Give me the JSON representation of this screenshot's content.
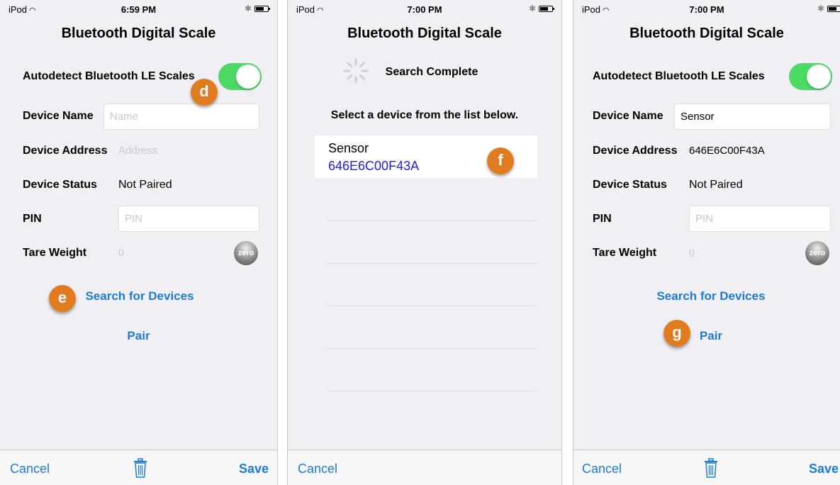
{
  "screens": [
    {
      "status": {
        "carrier": "iPod",
        "time": "6:59 PM"
      },
      "title": "Bluetooth Digital Scale",
      "autodetect_label": "Autodetect Bluetooth LE Scales",
      "device_name_label": "Device Name",
      "device_name_value": "",
      "device_name_placeholder": "Name",
      "device_address_label": "Device Address",
      "device_address_value": "Address",
      "device_status_label": "Device Status",
      "device_status_value": "Not Paired",
      "pin_label": "PIN",
      "pin_value": "",
      "pin_placeholder": "PIN",
      "tare_label": "Tare Weight",
      "tare_value": "0",
      "zero_label": "zero",
      "search_link": "Search for Devices",
      "pair_link": "Pair",
      "cancel_label": "Cancel",
      "save_label": "Save"
    },
    {
      "status": {
        "carrier": "iPod",
        "time": "7:00 PM"
      },
      "title": "Bluetooth Digital Scale",
      "search_status": "Search Complete",
      "instruction": "Select a device from the list below.",
      "devices": [
        {
          "name": "Sensor",
          "address": "646E6C00F43A"
        }
      ],
      "cancel_label": "Cancel"
    },
    {
      "status": {
        "carrier": "iPod",
        "time": "7:00 PM"
      },
      "title": "Bluetooth Digital Scale",
      "autodetect_label": "Autodetect Bluetooth LE Scales",
      "device_name_label": "Device Name",
      "device_name_value": "Sensor",
      "device_address_label": "Device Address",
      "device_address_value": "646E6C00F43A",
      "device_status_label": "Device Status",
      "device_status_value": "Not Paired",
      "pin_label": "PIN",
      "pin_value": "",
      "pin_placeholder": "PIN",
      "tare_label": "Tare Weight",
      "tare_value": "0",
      "zero_label": "zero",
      "search_link": "Search for Devices",
      "pair_link": "Pair",
      "cancel_label": "Cancel",
      "save_label": "Save"
    }
  ],
  "callouts": {
    "d": "d",
    "e": "e",
    "f": "f",
    "g": "g"
  },
  "colors": {
    "accent": "#1e7cd8",
    "toggle_on": "#4cd964",
    "callout": "#e07b1f",
    "device_address": "#2020e0"
  },
  "icons": {
    "wifi": "wifi-icon",
    "bluetooth": "bluetooth-icon",
    "battery": "battery-icon",
    "trash": "trash-icon",
    "spinner": "activity-spinner-icon"
  }
}
